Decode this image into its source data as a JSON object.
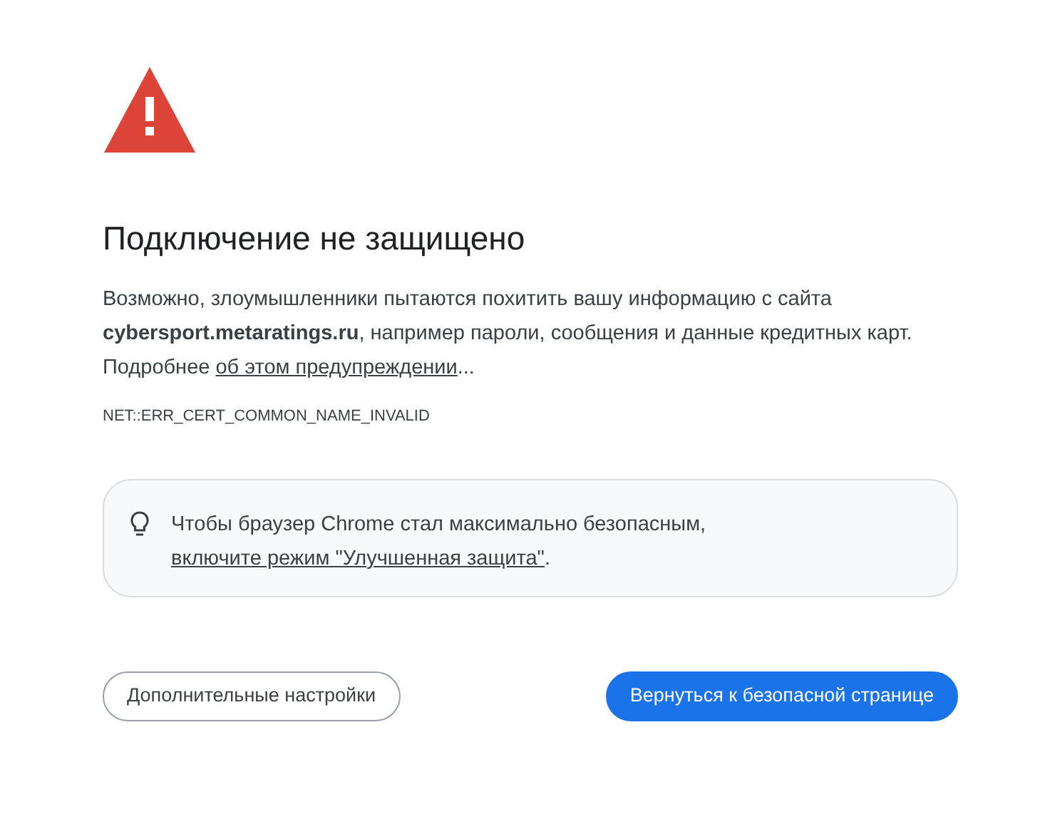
{
  "heading": "Подключение не защищено",
  "description": "Возможно, злоумышленники пытаются похитить вашу информацию с сайта **cybersport.metaratings.ru**, например пароли, сообщения и данные кредитных карт.",
  "details": {
    "prefix": "Подробнее",
    "link": "об этом предупреждении",
    "suffix": "..."
  },
  "error_code": "NET::ERR_CERT_COMMON_NAME_INVALID",
  "tip": {
    "text": "Чтобы браузер Chrome стал максимально безопасным,",
    "link": "включите режим \"Улучшенная защита\"",
    "suffix": "."
  },
  "buttons": [
    {
      "label": "Дополнительные настройки",
      "kind": "secondary"
    },
    {
      "label": "Вернуться к безопасной странице",
      "kind": "primary"
    }
  ]
}
